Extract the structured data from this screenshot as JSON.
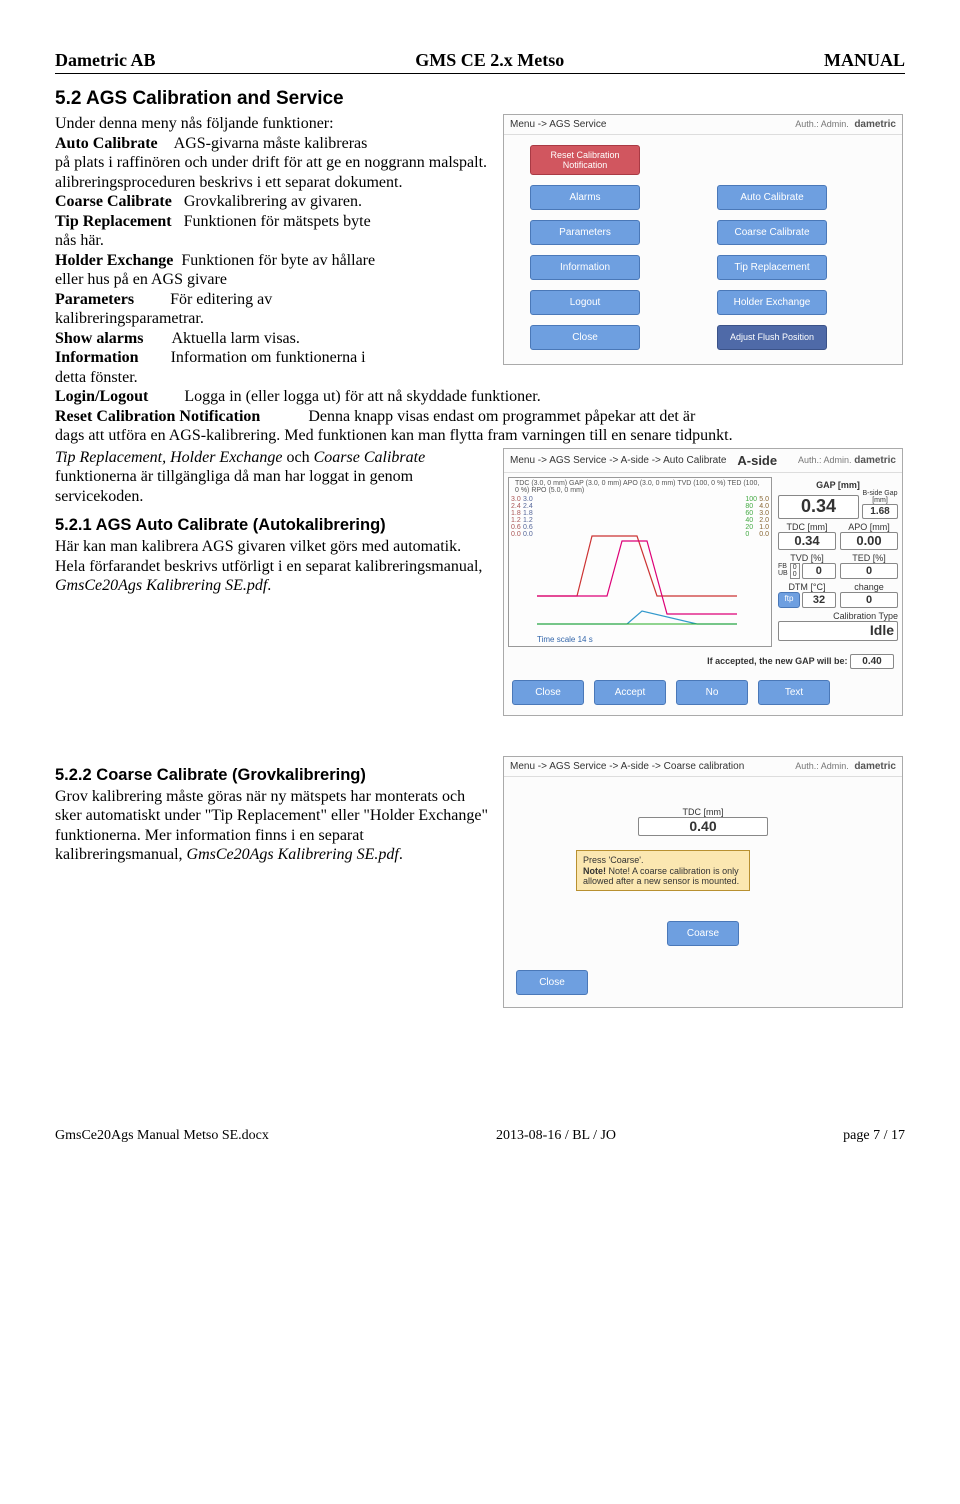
{
  "header": {
    "left": "Dametric AB",
    "center": "GMS CE 2.x Metso",
    "right": "MANUAL"
  },
  "s52": {
    "title": "5.2   AGS Calibration and Service",
    "intro": "Under denna meny nås följande funktioner:",
    "items": {
      "auto_calibrate_t": "Auto Calibrate",
      "auto_calibrate_d1": "AGS-givarna måste kalibreras",
      "auto_calibrate_d2": "på plats i raffinören och under drift för att ge en noggrann malspalt. alibreringsproceduren beskrivs i ett separat dokument.",
      "coarse_t": "Coarse Calibrate",
      "coarse_d": "Grovkalibrering av givaren.",
      "tip_t": "Tip Replacement",
      "tip_d": "Funktionen för mätspets byte",
      "tip_after": "nås här.",
      "holder_t": "Holder Exchange",
      "holder_d": "Funktionen för byte av hållare",
      "holder_after": "eller hus på en AGS givare",
      "param_t": "Parameters",
      "param_d": "För editering av",
      "param_after": "kalibreringsparametrar.",
      "show_t": "Show alarms",
      "show_d": "Aktuella larm visas.",
      "info_t": "Information",
      "info_d": "Information om funktionerna i",
      "info_after": "detta fönster.",
      "login_t": "Login/Logout",
      "login_d": "Logga in (eller logga ut) för att nå skyddade funktioner.",
      "reset_t": "Reset Calibration Notification",
      "reset_d": "Denna knapp visas endast om programmet påpekar att det är",
      "reset_after": "dags att utföra en AGS-kalibrering. Med funktionen kan man flytta fram varningen till en senare tidpunkt.",
      "tail1a": "Tip Replacement, Holder Exchange",
      "tail1b": " och ",
      "tail1c": "Coarse Calibrate",
      "tail1d": " funktionerna är tillgängliga då man har loggat in genom servicekoden."
    }
  },
  "shot1": {
    "breadcrumb": "Menu -> AGS Service",
    "auth": "Auth.: Admin.",
    "brand": "dametric",
    "btns": {
      "reset": "Reset Calibration Notification",
      "autocal": "Auto Calibrate",
      "alarms": "Alarms",
      "coarse": "Coarse Calibrate",
      "params": "Parameters",
      "tip": "Tip Replacement",
      "info": "Information",
      "holder": "Holder Exchange",
      "logout": "Logout",
      "flush": "Adjust Flush Position",
      "close": "Close"
    }
  },
  "s521": {
    "title": "5.2.1   AGS Auto Calibrate (Autokalibrering)",
    "p1": "Här kan man kalibrera AGS givaren vilket görs med automatik.",
    "p2a": "Hela förfarandet beskrivs utförligt i en separat kalibreringsmanual, ",
    "p2b": "GmsCe20Ags Kalibrering SE.pdf",
    "p2c": "."
  },
  "shot2": {
    "breadcrumb": "Menu -> AGS Service -> A-side -> Auto Calibrate",
    "aside": "A-side",
    "auth": "Auth.: Admin.",
    "brand": "dametric",
    "legend": "TDC (3.0, 0 mm)    GAP (3.0, 0 mm)    APO (3.0, 0 mm)    TVD (100, 0 %)    TED (100, 0 %)    RPO (5.0, 0 mm)",
    "xscale": "Time scale   14 s",
    "gap_label": "GAP [mm]",
    "gap_val": "0.34",
    "bside_label": "B-side Gap [mm]",
    "bside_val": "1.68",
    "tdc_label": "TDC [mm]",
    "tdc_val": "0.34",
    "apo_label": "APO [mm]",
    "apo_val": "0.00",
    "tvd_label": "TVD [%]",
    "tvd_val": "0",
    "ted_label": "TED [%]",
    "ted_val": "0",
    "fb": "FB",
    "fb_val": "0",
    "ub": "UB",
    "ub_val": "0",
    "dtm_label": "DTM [°C]",
    "dtm_val": "32",
    "change_label": "change",
    "change_val": "0",
    "ftp": "ftp",
    "catype": "Calibration Type",
    "idle": "Idle",
    "accept_line_a": "If accepted, the new GAP will be:",
    "accept_val": "0.40",
    "btns": {
      "close": "Close",
      "accept": "Accept",
      "no": "No",
      "text": "Text"
    }
  },
  "s522": {
    "title": "5.2.2   Coarse Calibrate (Grovkalibrering)",
    "p1a": "Grov kalibrering måste göras när ny mätspets har monterats och sker automatiskt under \"Tip Replacement\" eller \"Holder Exchange\" funktionerna. Mer information finns i en separat kalibreringsmanual, ",
    "p1b": "GmsCe20Ags Kalibrering SE.pdf",
    "p1c": "."
  },
  "shot3": {
    "breadcrumb": "Menu -> AGS Service -> A-side -> Coarse calibration",
    "auth": "Auth.: Admin.",
    "brand": "dametric",
    "tdc_label": "TDC [mm]",
    "tdc_val": "0.40",
    "tip1": "Press 'Coarse'.",
    "tip2": "Note! A coarse calibration is only allowed after a new sensor is mounted.",
    "btns": {
      "coarse": "Coarse",
      "close": "Close"
    }
  },
  "footer": {
    "left": "GmsCe20Ags Manual Metso SE.docx",
    "center": "2013-08-16 / BL / JO",
    "right": "page 7 / 17"
  }
}
